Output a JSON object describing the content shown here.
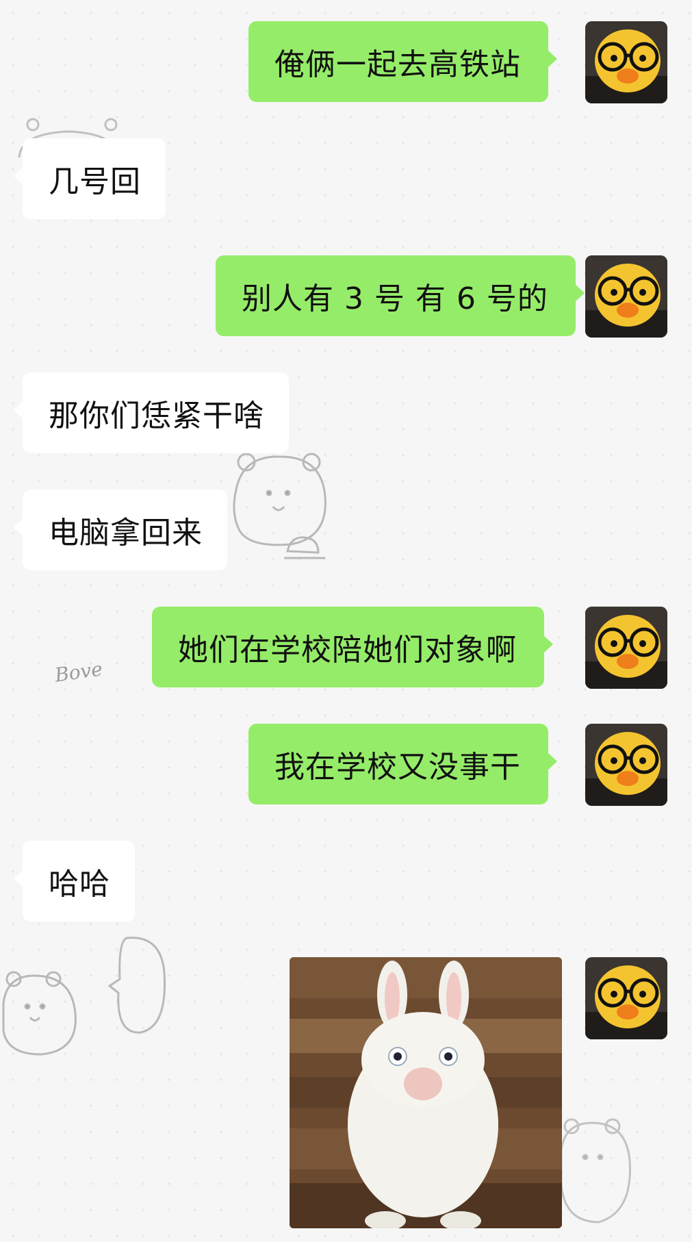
{
  "messages": [
    {
      "side": "out",
      "text": "俺俩一起去高铁站"
    },
    {
      "side": "in",
      "text": "几号回"
    },
    {
      "side": "out",
      "text": "别人有 3 号 有 6 号的"
    },
    {
      "side": "in",
      "text": "那你们恁紧干啥"
    },
    {
      "side": "in",
      "text": "电脑拿回来"
    },
    {
      "side": "out",
      "text": "她们在学校陪她们对象啊"
    },
    {
      "side": "out",
      "text": "我在学校又没事干"
    },
    {
      "side": "in",
      "text": "哈哈"
    },
    {
      "side": "out",
      "type": "sticker",
      "icon": "white-rabbit-sticker"
    }
  ],
  "decorations": {
    "love_doodle": "Bove",
    "avatar_icon": "duck-with-glasses-icon"
  },
  "colors": {
    "outgoing_bubble": "#95ec69",
    "incoming_bubble": "#ffffff",
    "background": "#f6f6f6"
  }
}
